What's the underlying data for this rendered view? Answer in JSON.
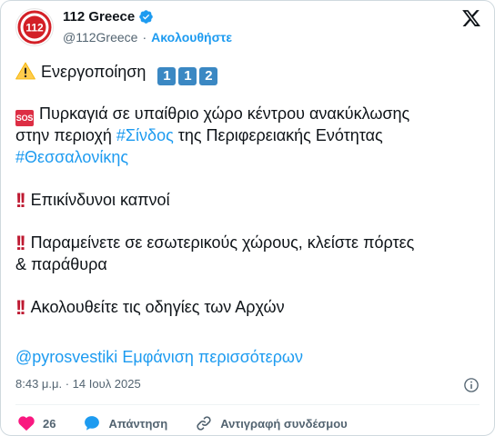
{
  "header": {
    "display_name": "112 Greece",
    "handle": "@112Greece",
    "separator": "·",
    "follow_label": "Ακολουθήστε",
    "avatar_text": "112"
  },
  "tweet": {
    "line1_text": "Ενεργοποίηση",
    "keycaps": [
      "1",
      "1",
      "2"
    ],
    "sos_label": "SOS",
    "l2_text": "Πυρκαγιά σε υπαίθριο χώρο κέντρου ανακύκλωσης",
    "l3_pre": "στην περιοχή ",
    "l3_tag": "#Σίνδος",
    "l3_post": " της Περιφερειακής Ενότητας",
    "l4_tag": "#Θεσσαλονίκης",
    "bang": "!!",
    "l5_text": "Επικίνδυνοι καπνοί",
    "l6_text": "Παραμείνετε σε εσωτερικούς χώρους, κλείστε πόρτες",
    "l7_text": "& παράθυρα",
    "l8_text": "Ακολουθείτε τις οδηγίες των Αρχών",
    "mention": "@pyrosvestiki",
    "show_more": "Εμφάνιση περισσότερων"
  },
  "timestamp": "8:43 μ.μ. · 14 Ιουλ 2025",
  "actions": {
    "like_count": "26",
    "reply_label": "Απάντηση",
    "copy_link_label": "Αντιγραφή συνδέσμου"
  },
  "colors": {
    "link": "#1d9bf0",
    "text": "#0f1419",
    "muted": "#536471",
    "like": "#f91880",
    "avatar_red": "#d32027"
  },
  "icons": {
    "verified": "verified-badge-icon",
    "x_logo": "x-logo-icon",
    "warning": "warning-icon",
    "info": "info-icon",
    "like": "heart-icon",
    "reply": "reply-bubble-icon",
    "link": "link-icon"
  }
}
